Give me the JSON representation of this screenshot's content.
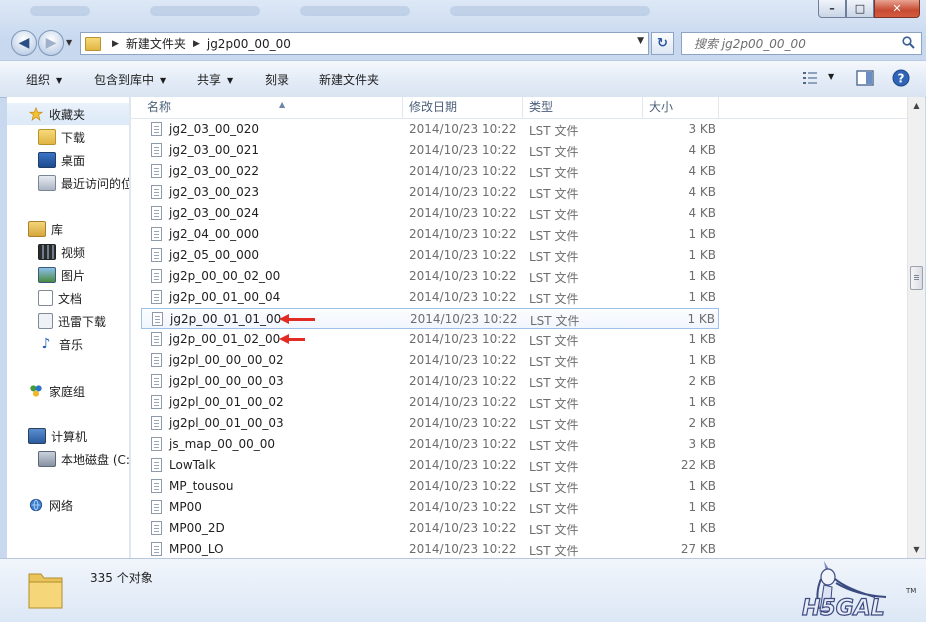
{
  "window": {
    "minimize_glyph": "–",
    "maximize_glyph": "□",
    "close_glyph": "✕"
  },
  "address": {
    "crumbs": [
      "新建文件夹",
      "jg2p00_00_00"
    ],
    "search_placeholder": "搜索 jg2p00_00_00"
  },
  "toolbar": {
    "organize": "组织",
    "include": "包含到库中",
    "share": "共享",
    "burn": "刻录",
    "new_folder": "新建文件夹"
  },
  "sidebar": {
    "groups": [
      {
        "label": "收藏夹",
        "icon": "star-icon",
        "items": [
          {
            "label": "下载",
            "icon": "downloads-icon"
          },
          {
            "label": "桌面",
            "icon": "desktop-icon"
          },
          {
            "label": "最近访问的位",
            "icon": "recent-places-icon"
          }
        ]
      },
      {
        "label": "库",
        "icon": "library-icon",
        "items": [
          {
            "label": "视频",
            "icon": "videos-icon"
          },
          {
            "label": "图片",
            "icon": "pictures-icon"
          },
          {
            "label": "文档",
            "icon": "documents-icon"
          },
          {
            "label": "迅雷下载",
            "icon": "thunder-downloads-icon"
          },
          {
            "label": "音乐",
            "icon": "music-icon"
          }
        ]
      },
      {
        "label": "家庭组",
        "icon": "homegroup-icon",
        "items": []
      },
      {
        "label": "计算机",
        "icon": "computer-icon",
        "items": [
          {
            "label": "本地磁盘 (C:)",
            "icon": "local-disk-icon"
          }
        ]
      },
      {
        "label": "网络",
        "icon": "network-icon",
        "items": []
      }
    ]
  },
  "columns": {
    "name": "名称",
    "date": "修改日期",
    "type": "类型",
    "size": "大小"
  },
  "files": [
    {
      "name": "jg2_03_00_020",
      "date": "2014/10/23 10:22",
      "type": "LST 文件",
      "size": "3 KB"
    },
    {
      "name": "jg2_03_00_021",
      "date": "2014/10/23 10:22",
      "type": "LST 文件",
      "size": "4 KB"
    },
    {
      "name": "jg2_03_00_022",
      "date": "2014/10/23 10:22",
      "type": "LST 文件",
      "size": "4 KB"
    },
    {
      "name": "jg2_03_00_023",
      "date": "2014/10/23 10:22",
      "type": "LST 文件",
      "size": "4 KB"
    },
    {
      "name": "jg2_03_00_024",
      "date": "2014/10/23 10:22",
      "type": "LST 文件",
      "size": "4 KB"
    },
    {
      "name": "jg2_04_00_000",
      "date": "2014/10/23 10:22",
      "type": "LST 文件",
      "size": "1 KB"
    },
    {
      "name": "jg2_05_00_000",
      "date": "2014/10/23 10:22",
      "type": "LST 文件",
      "size": "1 KB"
    },
    {
      "name": "jg2p_00_00_02_00",
      "date": "2014/10/23 10:22",
      "type": "LST 文件",
      "size": "1 KB"
    },
    {
      "name": "jg2p_00_01_00_04",
      "date": "2014/10/23 10:22",
      "type": "LST 文件",
      "size": "1 KB"
    },
    {
      "name": "jg2p_00_01_01_00",
      "date": "2014/10/23 10:22",
      "type": "LST 文件",
      "size": "1 KB",
      "selected": true
    },
    {
      "name": "jg2p_00_01_02_00",
      "date": "2014/10/23 10:22",
      "type": "LST 文件",
      "size": "1 KB"
    },
    {
      "name": "jg2pl_00_00_00_02",
      "date": "2014/10/23 10:22",
      "type": "LST 文件",
      "size": "1 KB"
    },
    {
      "name": "jg2pl_00_00_00_03",
      "date": "2014/10/23 10:22",
      "type": "LST 文件",
      "size": "2 KB"
    },
    {
      "name": "jg2pl_00_01_00_02",
      "date": "2014/10/23 10:22",
      "type": "LST 文件",
      "size": "1 KB"
    },
    {
      "name": "jg2pl_00_01_00_03",
      "date": "2014/10/23 10:22",
      "type": "LST 文件",
      "size": "2 KB"
    },
    {
      "name": "js_map_00_00_00",
      "date": "2014/10/23 10:22",
      "type": "LST 文件",
      "size": "3 KB"
    },
    {
      "name": "LowTalk",
      "date": "2014/10/23 10:22",
      "type": "LST 文件",
      "size": "22 KB"
    },
    {
      "name": "MP_tousou",
      "date": "2014/10/23 10:22",
      "type": "LST 文件",
      "size": "1 KB"
    },
    {
      "name": "MP00",
      "date": "2014/10/23 10:22",
      "type": "LST 文件",
      "size": "1 KB"
    },
    {
      "name": "MP00_2D",
      "date": "2014/10/23 10:22",
      "type": "LST 文件",
      "size": "1 KB"
    },
    {
      "name": "MP00_LO",
      "date": "2014/10/23 10:22",
      "type": "LST 文件",
      "size": "27 KB"
    }
  ],
  "status": {
    "count": "335 个对象"
  },
  "watermark": {
    "text": "H5GAL",
    "tm": "TM"
  },
  "colors": {
    "annotation_arrow": "#e22b22",
    "selection_border": "#9fc1e7"
  }
}
